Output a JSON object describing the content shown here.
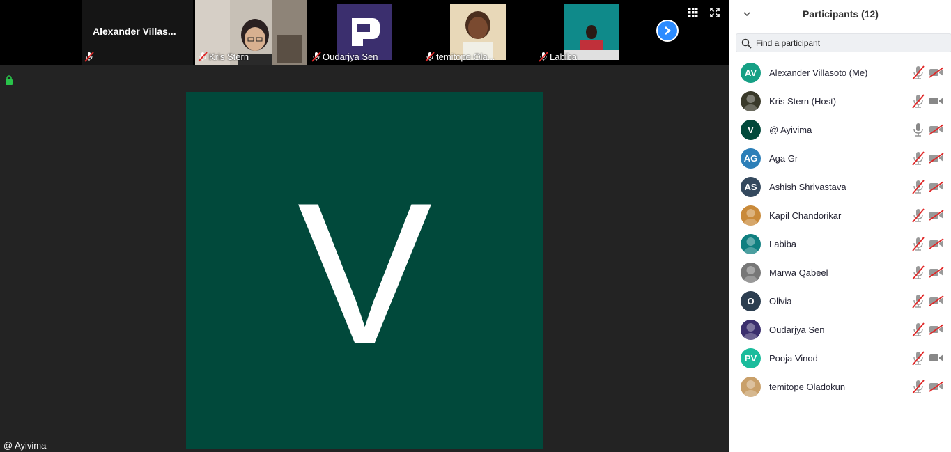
{
  "filmstrip": {
    "tiles": [
      {
        "name": "Alexander  Villas...",
        "muted": true
      },
      {
        "name": "Kris Stern",
        "muted": true
      },
      {
        "name": "Oudarjya Sen",
        "muted": true
      },
      {
        "name": "temitope Ola...",
        "muted": true
      },
      {
        "name": "Labiba",
        "muted": true
      }
    ],
    "next_icon": "chevron-right-icon",
    "grid_icon": "gallery-grid-icon",
    "fullscreen_icon": "fullscreen-icon"
  },
  "stage": {
    "speaker_initial": "V",
    "speaker_name": "@ Ayivima",
    "tile_color": "#01493b",
    "lock_icon": "lock-icon"
  },
  "panel": {
    "title": "Participants (12)",
    "search_placeholder": "Find a participant",
    "participants": [
      {
        "name": "Alexander Villasoto (Me)",
        "initials": "AV",
        "color": "#16a085",
        "mic": "muted",
        "cam": "off"
      },
      {
        "name": "Kris Stern (Host)",
        "initials": "",
        "color": "#3a3a2a",
        "mic": "muted",
        "cam": "on"
      },
      {
        "name": "@ Ayivima",
        "initials": "V",
        "color": "#01493b",
        "mic": "on",
        "cam": "off"
      },
      {
        "name": "Aga Gr",
        "initials": "AG",
        "color": "#2c7fb8",
        "mic": "muted",
        "cam": "off"
      },
      {
        "name": "Ashish Shrivastava",
        "initials": "AS",
        "color": "#34495e",
        "mic": "muted",
        "cam": "off"
      },
      {
        "name": "Kapil Chandorikar",
        "initials": "",
        "color": "#c98a3a",
        "mic": "muted",
        "cam": "off"
      },
      {
        "name": "Labiba",
        "initials": "",
        "color": "#0f7f80",
        "mic": "muted",
        "cam": "off"
      },
      {
        "name": "Marwa Qabeel",
        "initials": "",
        "color": "#777777",
        "mic": "muted",
        "cam": "off"
      },
      {
        "name": "Olivia",
        "initials": "O",
        "color": "#2c3e50",
        "mic": "muted",
        "cam": "off"
      },
      {
        "name": "Oudarjya Sen",
        "initials": "",
        "color": "#3b2f6e",
        "mic": "muted",
        "cam": "off"
      },
      {
        "name": "Pooja Vinod",
        "initials": "PV",
        "color": "#1abc9c",
        "mic": "muted",
        "cam": "on"
      },
      {
        "name": "temitope Oladokun",
        "initials": "",
        "color": "#c9a06a",
        "mic": "muted",
        "cam": "off"
      }
    ]
  }
}
